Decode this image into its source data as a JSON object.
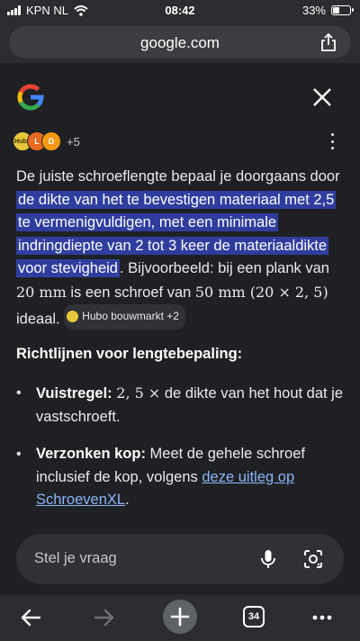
{
  "status_bar": {
    "carrier": "KPN NL",
    "time": "08:42",
    "battery": "33%",
    "battery_level": 0.33
  },
  "url_bar": {
    "domain": "google.com"
  },
  "overview": {
    "sources_more": "+5",
    "favicon_labels": [
      "Hubo",
      "L",
      "D"
    ],
    "para": {
      "t1": "De juiste schroeflengte bepaal je doorgaans door ",
      "highlight": "de dikte van het te bevestigen materiaal met 2,5 te vermenigvuldigen, met een minimale indringdiepte van 2 tot 3 keer de materiaaldikte voor stevigheid",
      "t2": ". Bijvoorbeeld: bij een plank van ",
      "m1": "20 mm",
      "t3": " is een schroef van ",
      "m2": "50 mm (20 × 2, 5)",
      "t4": " ideaal. ",
      "chip": "Hubo bouwmarkt +2"
    },
    "heading": "Richtlijnen voor lengtebepaling:",
    "bullets": [
      {
        "bold": "Vuistregel:",
        "math": "2, 5 ×",
        "text": " de dikte van het hout dat je vastschroeft."
      },
      {
        "bold": "Verzonken kop:",
        "text": " Meet de gehele schroef inclusief de kop, volgens ",
        "link": "deze uitleg op SchroevenXL",
        "after": "."
      }
    ]
  },
  "ask": {
    "placeholder": "Stel je vraag"
  },
  "toolbar": {
    "tab_count": "34"
  },
  "colors": {
    "highlight": "#2f3e9e",
    "link": "#8ab4f8",
    "background": "#1f2023"
  },
  "icons": [
    "signal-icon",
    "wifi-icon",
    "battery-icon",
    "share-icon",
    "google-logo",
    "close-icon",
    "more-options-icon",
    "mic-icon",
    "lens-icon",
    "back-icon",
    "forward-icon",
    "new-tab-icon",
    "tabs-icon",
    "menu-icon"
  ]
}
